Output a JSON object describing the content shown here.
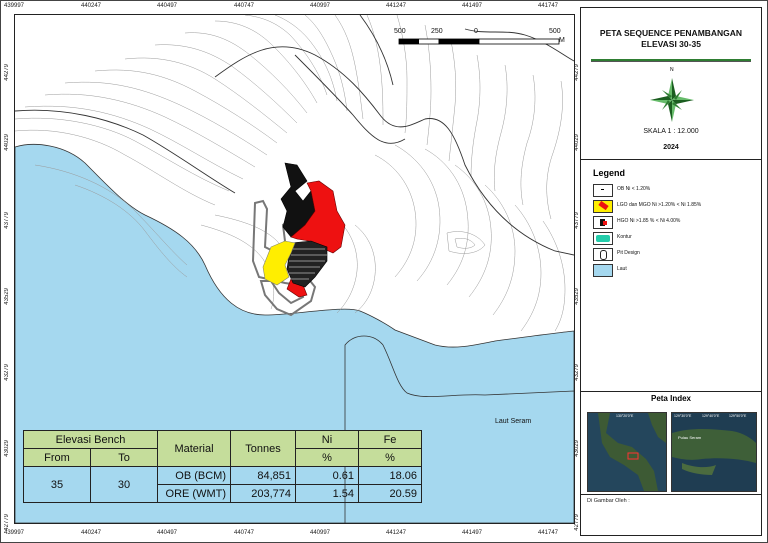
{
  "map": {
    "x_coords": [
      "439997",
      "440247",
      "440497",
      "440747",
      "440997",
      "441247",
      "441497",
      "441747"
    ],
    "y_coords": [
      "44279",
      "44029",
      "43779",
      "43529",
      "43279",
      "43029",
      "42779"
    ],
    "scale_bar": {
      "labels": [
        "500",
        "250",
        "0",
        "500"
      ],
      "unit": "M"
    },
    "sea_label": "Laut Seram"
  },
  "panel": {
    "title_line1": "PETA SEQUENCE PENAMBANGAN",
    "title_line2": "ELEVASI  30-35",
    "scale": "SKALA   1 : 12.000",
    "year": "2024",
    "north_label": "N",
    "legend_title": "Legend",
    "legend": [
      {
        "label": "OB Ni < 1.20%",
        "swatch": "ob"
      },
      {
        "label": "LGO dan MGO Ni >1.20% < Ni 1.85%",
        "swatch": "lgo"
      },
      {
        "label": "HGO Ni >1.85 % < Ni 4.00%",
        "swatch": "hgo"
      },
      {
        "label": "Kontur",
        "swatch": "kontur"
      },
      {
        "label": "Pit Design",
        "swatch": "pit"
      },
      {
        "label": "Laut",
        "swatch": "laut"
      }
    ],
    "peta_index_title": "Peta Index",
    "thumb_coords_left": "130°20'0\"E",
    "thumb_coords_right": [
      "129°30'0\"E",
      "129°40'0\"E",
      "129°50'0\"E"
    ],
    "thumb_place": "Pulau Seram",
    "drawn_by": "Di Gambar Oleh :"
  },
  "table": {
    "h_elevasi": "Elevasi Bench",
    "h_material": "Material",
    "h_tonnes": "Tonnes",
    "h_ni": "Ni",
    "h_fe": "Fe",
    "h_from": "From",
    "h_to": "To",
    "h_ni_unit": "%",
    "h_fe_unit": "%",
    "from": "35",
    "to": "30",
    "rows": [
      {
        "material": "OB (BCM)",
        "tonnes": "84,851",
        "ni": "0.61",
        "fe": "18.06"
      },
      {
        "material": "ORE (WMT)",
        "tonnes": "203,774",
        "ni": "1.54",
        "fe": "20.59"
      }
    ]
  },
  "colors": {
    "sea": "#a5d8ef",
    "ore_red": "#ee1111",
    "ore_yellow": "#ffee00",
    "accent_green": "#2e7d32",
    "table_header": "#c5dd9b"
  }
}
